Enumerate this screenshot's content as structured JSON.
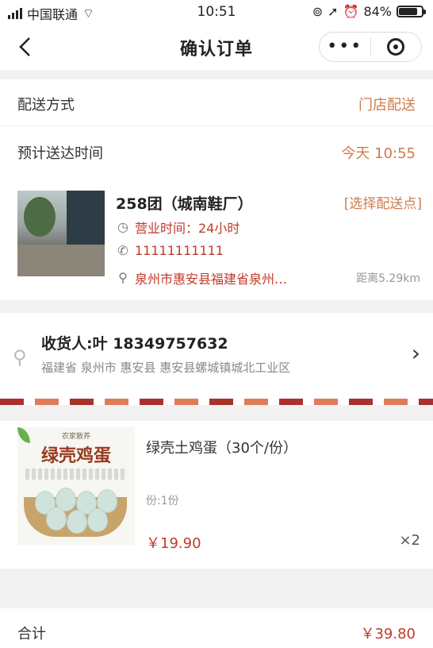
{
  "status_bar": {
    "carrier": "中国联通",
    "time": "10:51",
    "battery": "84%",
    "battery_level": 0.84
  },
  "nav": {
    "title": "确认订单",
    "more": "•••"
  },
  "delivery": {
    "method_label": "配送方式",
    "method_value": "门店配送",
    "eta_label": "预计送达时间",
    "eta_value": "今天 10:55"
  },
  "store": {
    "name": "258团（城南鞋厂）",
    "pick_point": "[选择配送点]",
    "hours": "营业时间：24小时",
    "phone": "11111111111",
    "address": "泉州市惠安县福建省泉州…",
    "distance": "距离5.29km"
  },
  "consignee": {
    "who": "收货人:叶 18349757632",
    "address": "福建省 泉州市 惠安县 惠安县螺城镇城北工业区"
  },
  "product": {
    "image_brand": "农家散养",
    "image_title": "绿壳鸡蛋",
    "name": "绿壳土鸡蛋（30个/份）",
    "spec": "份:1份",
    "price": "￥19.90",
    "quantity": "×2"
  },
  "total": {
    "label": "合计",
    "value": "￥39.80"
  },
  "icons": {
    "back": "chevron-left-icon",
    "more": "more-dots-icon",
    "target": "target-icon",
    "clock": "clock-icon",
    "phone": "phone-icon",
    "location": "location-pin-icon",
    "chevron": "chevron-right-icon"
  },
  "colors": {
    "accent": "#d17a4c",
    "price": "#c0392b"
  }
}
